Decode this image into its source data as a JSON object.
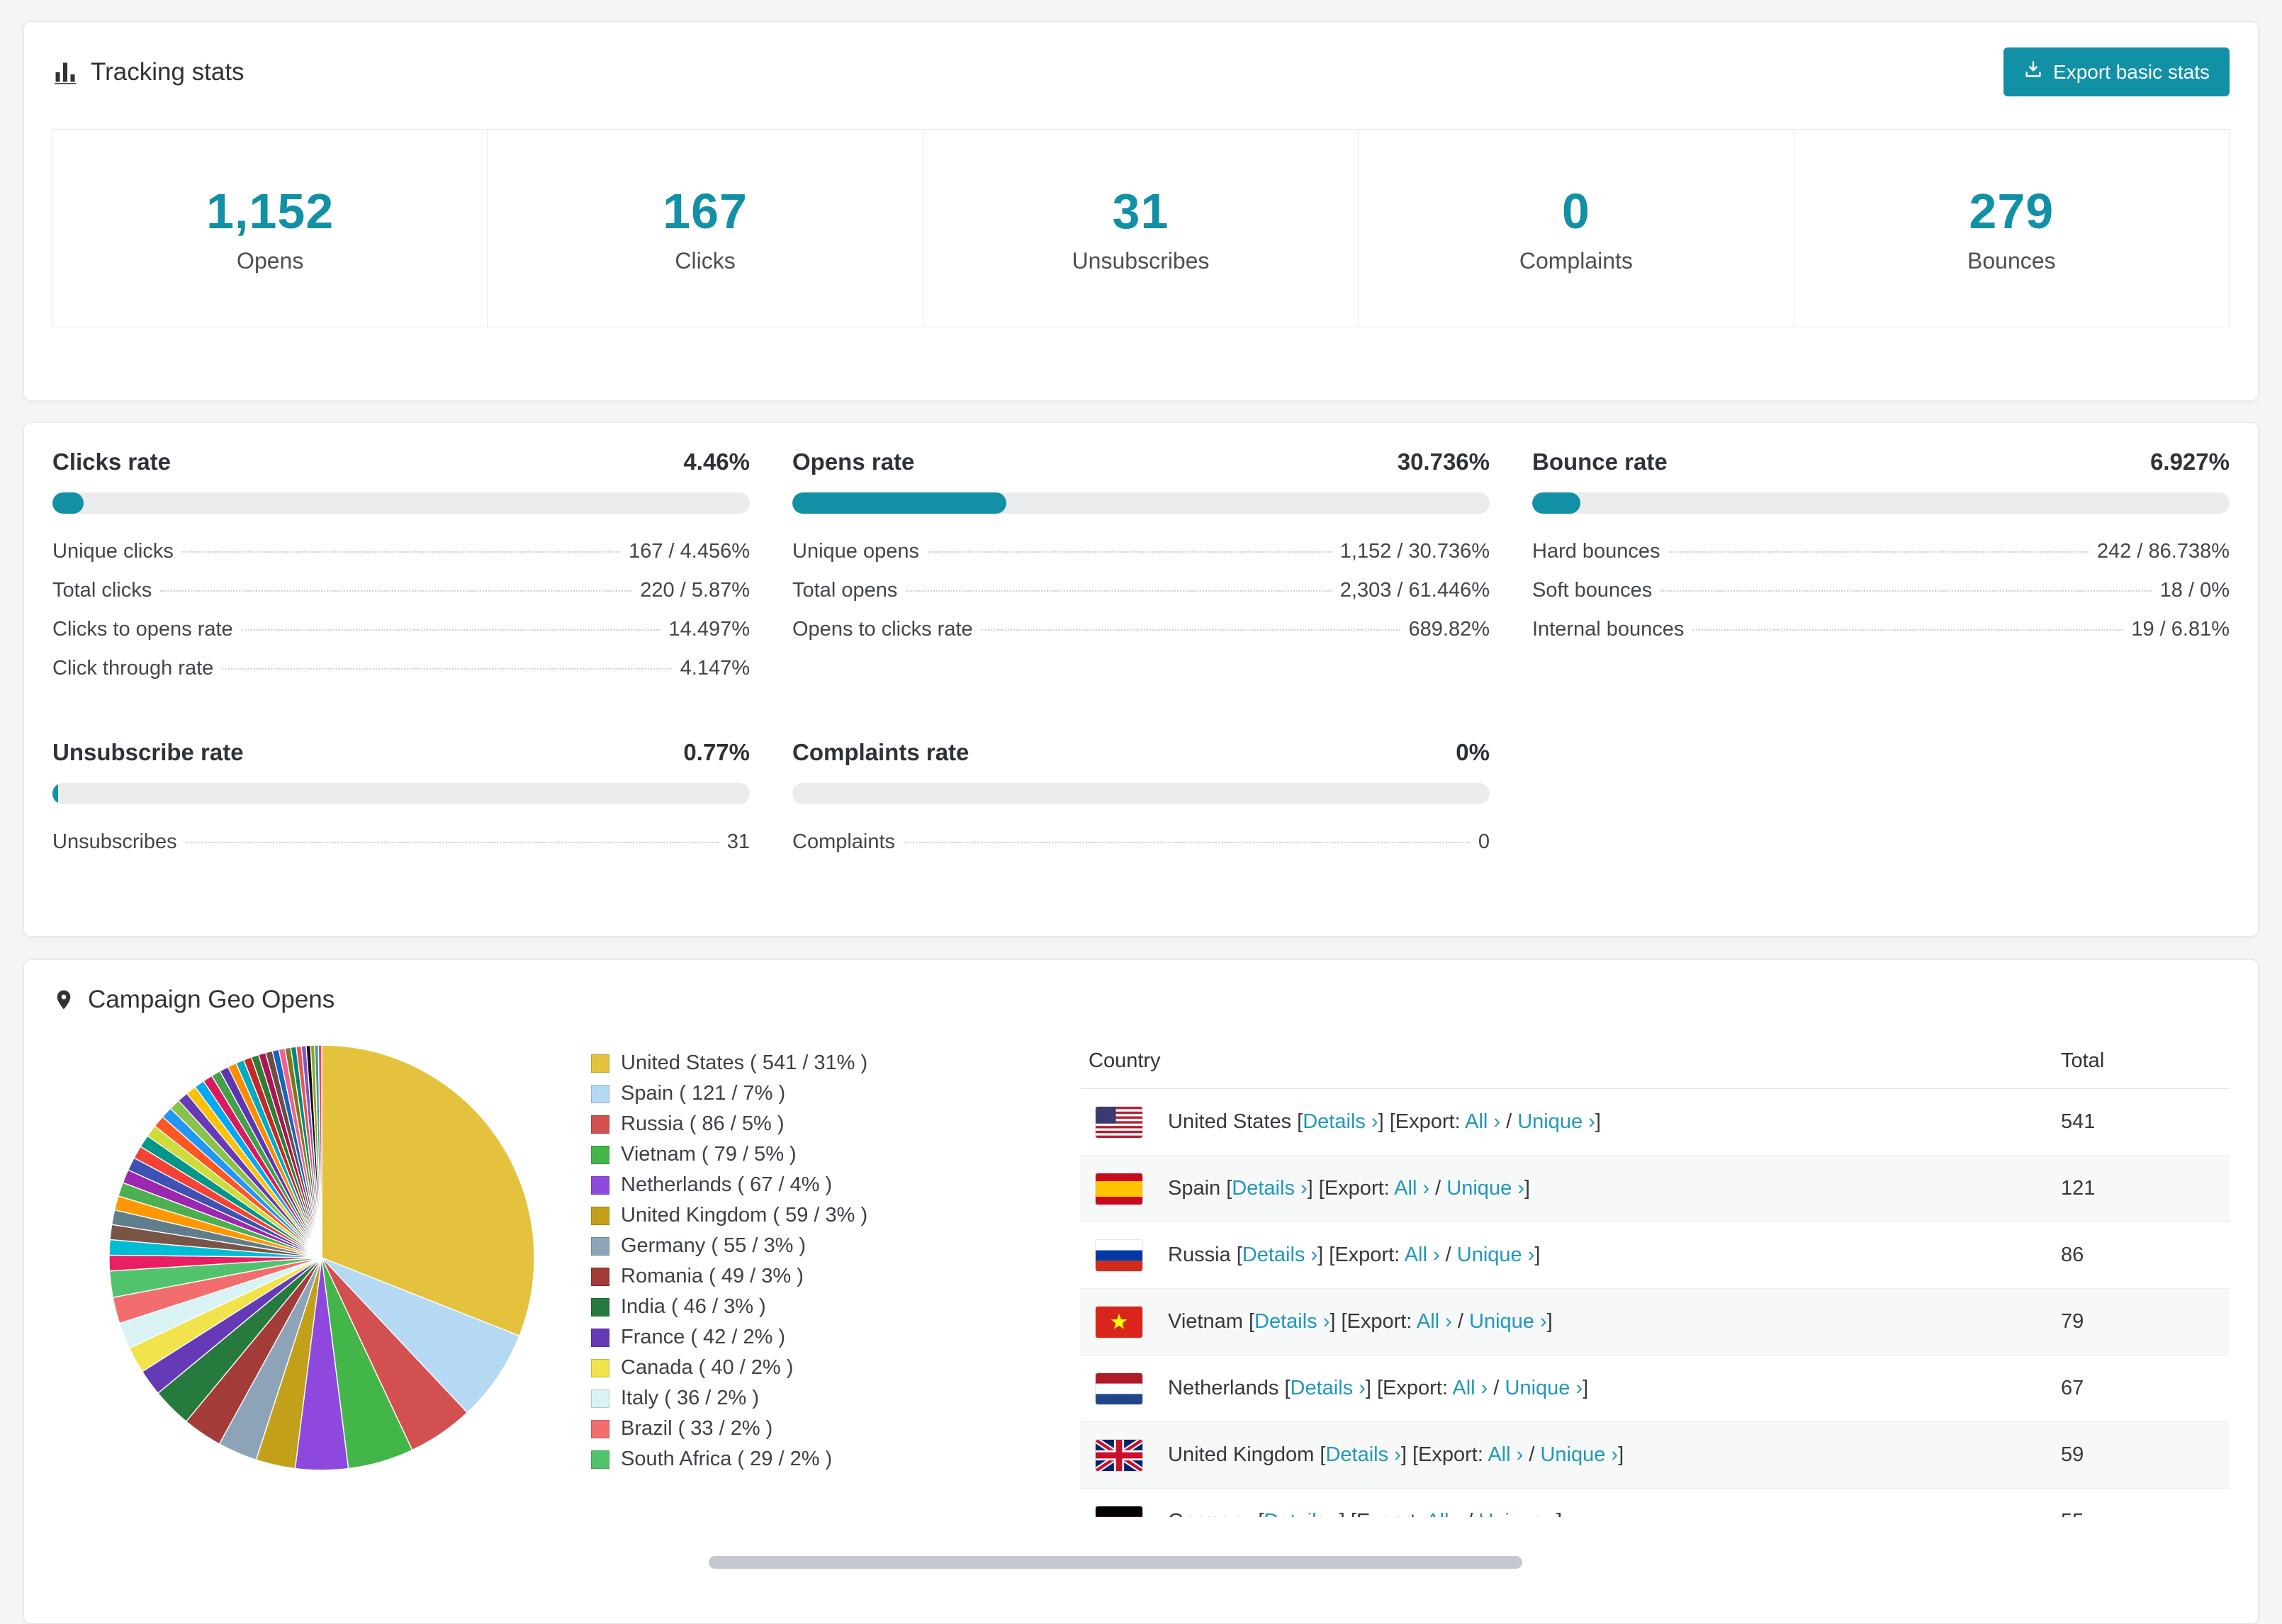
{
  "theme": {
    "accent": "#1190a6",
    "link_color": "#2097bd",
    "bar_track": "#e9ebed"
  },
  "tracking": {
    "title": "Tracking stats",
    "export_button": "Export basic stats",
    "summary": [
      {
        "value": "1,152",
        "label": "Opens"
      },
      {
        "value": "167",
        "label": "Clicks"
      },
      {
        "value": "31",
        "label": "Unsubscribes"
      },
      {
        "value": "0",
        "label": "Complaints"
      },
      {
        "value": "279",
        "label": "Bounces"
      }
    ]
  },
  "rates": {
    "primary": [
      {
        "title": "Clicks rate",
        "value": "4.46%",
        "percent": 4.46,
        "stats": [
          {
            "label": "Unique clicks",
            "value": "167 / 4.456%"
          },
          {
            "label": "Total clicks",
            "value": "220 / 5.87%"
          },
          {
            "label": "Clicks to opens rate",
            "value": "14.497%"
          },
          {
            "label": "Click through rate",
            "value": "4.147%"
          }
        ]
      },
      {
        "title": "Opens rate",
        "value": "30.736%",
        "percent": 30.736,
        "stats": [
          {
            "label": "Unique opens",
            "value": "1,152 / 30.736%"
          },
          {
            "label": "Total opens",
            "value": "2,303 / 61.446%"
          },
          {
            "label": "Opens to clicks rate",
            "value": "689.82%"
          }
        ]
      },
      {
        "title": "Bounce rate",
        "value": "6.927%",
        "percent": 6.927,
        "stats": [
          {
            "label": "Hard bounces",
            "value": "242 / 86.738%"
          },
          {
            "label": "Soft bounces",
            "value": "18 / 0%"
          },
          {
            "label": "Internal bounces",
            "value": "19 / 6.81%"
          }
        ]
      }
    ],
    "secondary": [
      {
        "title": "Unsubscribe rate",
        "value": "0.77%",
        "percent": 0.77,
        "stats": [
          {
            "label": "Unsubscribes",
            "value": "31"
          }
        ]
      },
      {
        "title": "Complaints rate",
        "value": "0%",
        "percent": 0,
        "stats": [
          {
            "label": "Complaints",
            "value": "0"
          }
        ]
      }
    ]
  },
  "geo": {
    "title": "Campaign Geo Opens",
    "legend_template": "{name} ( {total} / {percent}% )",
    "table": {
      "headers": {
        "country": "Country",
        "total": "Total"
      },
      "links": {
        "details": "Details ›",
        "export_label": "Export:",
        "all": "All ›",
        "slash": "/",
        "unique": "Unique ›"
      }
    },
    "countries": [
      {
        "name": "United States",
        "flag": "us",
        "total": "541",
        "percent": "31",
        "color": "#e4c23e",
        "in_table": true
      },
      {
        "name": "Spain",
        "flag": "es",
        "total": "121",
        "percent": "7",
        "color": "#b5d9f2",
        "in_table": true
      },
      {
        "name": "Russia",
        "flag": "ru",
        "total": "86",
        "percent": "5",
        "color": "#d25050",
        "in_table": true
      },
      {
        "name": "Vietnam",
        "flag": "vn",
        "total": "79",
        "percent": "5",
        "color": "#43b649",
        "in_table": true
      },
      {
        "name": "Netherlands",
        "flag": "nl",
        "total": "67",
        "percent": "4",
        "color": "#8f48dd",
        "in_table": true
      },
      {
        "name": "United Kingdom",
        "flag": "gb",
        "total": "59",
        "percent": "3",
        "color": "#c2a01a",
        "in_table": true
      },
      {
        "name": "Germany",
        "flag": "de",
        "total": "55",
        "percent": "3",
        "color": "#8da4b8",
        "in_table": true
      },
      {
        "name": "Romania",
        "flag": "ro",
        "total": "49",
        "percent": "3",
        "color": "#a33b38",
        "in_table": false
      },
      {
        "name": "India",
        "flag": "in",
        "total": "46",
        "percent": "3",
        "color": "#267a3e",
        "in_table": false
      },
      {
        "name": "France",
        "flag": "fr",
        "total": "42",
        "percent": "2",
        "color": "#6639b7",
        "in_table": false
      },
      {
        "name": "Canada",
        "flag": "ca",
        "total": "40",
        "percent": "2",
        "color": "#f2e34c",
        "in_table": false
      },
      {
        "name": "Italy",
        "flag": "it",
        "total": "36",
        "percent": "2",
        "color": "#d9f3f5",
        "in_table": false
      },
      {
        "name": "Brazil",
        "flag": "br",
        "total": "33",
        "percent": "2",
        "color": "#f26d6d",
        "in_table": false
      },
      {
        "name": "South Africa",
        "flag": "za",
        "total": "29",
        "percent": "2",
        "color": "#52c36d",
        "in_table": false
      }
    ],
    "pie_other_colors": [
      "#e91e63",
      "#00bcd4",
      "#795548",
      "#607d8b",
      "#ff9800",
      "#4caf50",
      "#9c27b0",
      "#3f51b5",
      "#f44336",
      "#009688",
      "#cddc39",
      "#ff5722",
      "#2196f3",
      "#8bc34a",
      "#673ab7",
      "#ffc107",
      "#03a9f4",
      "#d81b60",
      "#43a047",
      "#5e35b1",
      "#fb8c00",
      "#00acc1",
      "#c62828",
      "#2e7d32",
      "#ad1457",
      "#6d4c41",
      "#1565c0",
      "#f06292",
      "#827717",
      "#00897b",
      "#ef5350",
      "#7e57c2",
      "#111111",
      "#9e9d24",
      "#26a69a",
      "#ec407a"
    ]
  },
  "chart_data": {
    "type": "pie",
    "title": "Campaign Geo Opens",
    "labels": [
      "United States",
      "Spain",
      "Russia",
      "Vietnam",
      "Netherlands",
      "United Kingdom",
      "Germany",
      "Romania",
      "India",
      "France",
      "Canada",
      "Italy",
      "Brazil",
      "South Africa"
    ],
    "values": [
      541,
      121,
      86,
      79,
      67,
      59,
      55,
      49,
      46,
      42,
      40,
      36,
      33,
      29
    ],
    "percent_labels": [
      31,
      7,
      5,
      5,
      4,
      3,
      3,
      3,
      3,
      2,
      2,
      2,
      2,
      2
    ],
    "colors": [
      "#e4c23e",
      "#b5d9f2",
      "#d25050",
      "#43b649",
      "#8f48dd",
      "#c2a01a",
      "#8da4b8",
      "#a33b38",
      "#267a3e",
      "#6639b7",
      "#f2e34c",
      "#d9f3f5",
      "#f26d6d",
      "#52c36d"
    ],
    "legend_position": "right",
    "note": "remaining ~36% of the pie is many small unlabeled country slices"
  }
}
